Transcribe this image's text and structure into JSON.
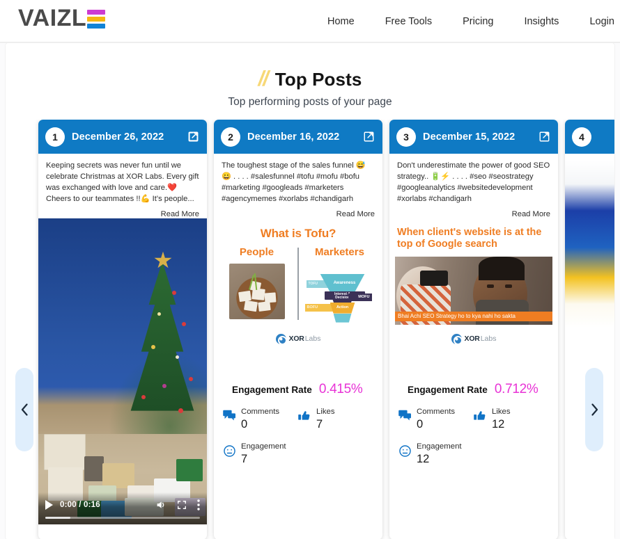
{
  "nav": {
    "logo_text": "VAIZL",
    "logo_bar_colors": [
      "#cc3cd1",
      "#f5b711",
      "#1183d6"
    ],
    "links": [
      {
        "label": "Home"
      },
      {
        "label": "Free Tools"
      },
      {
        "label": "Pricing"
      },
      {
        "label": "Insights"
      },
      {
        "label": "Login"
      }
    ]
  },
  "heading": {
    "slashes": "//",
    "title": "Top Posts",
    "subtitle": "Top performing posts of your page",
    "accent_color": "#f7d877"
  },
  "carousel": {
    "prev_label": "‹",
    "next_label": "›",
    "header_color": "#0f7ac4",
    "engagement_rate_color": "#e832d6"
  },
  "cards": [
    {
      "rank": "1",
      "date": "December 26, 2022",
      "open_icon": "external-link-icon",
      "text": "Keeping secrets was never fun until we celebrate Christmas at XOR Labs. Every gift was exchanged with love and care.❤️ Cheers to our teammates !!💪 It’s people...",
      "read_more": "Read More",
      "media_type": "video",
      "video": {
        "play_label": "play-button",
        "time": "0:00 / 0:16",
        "volume_icon": "volume-icon",
        "fullscreen_icon": "fullscreen-icon",
        "more_icon": "more-options-icon"
      }
    },
    {
      "rank": "2",
      "date": "December 16, 2022",
      "open_icon": "external-link-icon",
      "text": "The toughest stage of the sales funnel 😅😀 . . . . #salesfunnel #tofu #mofu #bofu #marketing #googleads #marketers #agencymemes #xorlabs #chandigarh",
      "read_more": "Read More",
      "media_type": "graphic-tofu",
      "graphic": {
        "title": "What is Tofu?",
        "col_left": "People",
        "col_right": "Marketers",
        "funnel_labels": [
          "TOFU",
          "Awareness",
          "Interest & Decision",
          "MOFU",
          "BOFU",
          "Action"
        ],
        "brand_bold": "XOR",
        "brand_light": "Labs"
      },
      "metrics": {
        "er_label": "Engagement Rate",
        "er_value": "0.415%",
        "comments_label": "Comments",
        "comments_value": "0",
        "likes_label": "Likes",
        "likes_value": "7",
        "engagement_label": "Engagement",
        "engagement_value": "7"
      }
    },
    {
      "rank": "3",
      "date": "December 15, 2022",
      "open_icon": "external-link-icon",
      "text": "Don't underestimate the power of good SEO strategy.. 🔋⚡ . . . . #seo #seostrategy #googleanalytics #websitedevelopment #xorlabs #chandigarh",
      "read_more": "Read More",
      "media_type": "graphic-meme",
      "graphic": {
        "title": "When client's website is at the top of Google search",
        "caption": "Bhai Achi SEO Strategy ho to kya nahi ho sakta",
        "brand_bold": "XOR",
        "brand_light": "Labs"
      },
      "metrics": {
        "er_label": "Engagement Rate",
        "er_value": "0.712%",
        "comments_label": "Comments",
        "comments_value": "0",
        "likes_label": "Likes",
        "likes_value": "12",
        "engagement_label": "Engagement",
        "engagement_value": "12"
      }
    },
    {
      "rank": "4",
      "date": "",
      "open_icon": "external-link-icon",
      "text": "",
      "read_more": "",
      "media_type": "partial"
    }
  ]
}
